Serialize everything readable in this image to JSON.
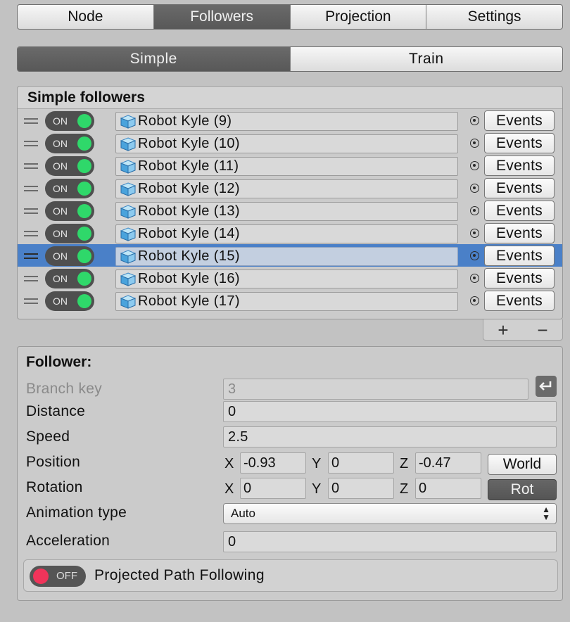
{
  "main_tabs": [
    {
      "label": "Node",
      "active": false
    },
    {
      "label": "Followers",
      "active": true
    },
    {
      "label": "Projection",
      "active": false
    },
    {
      "label": "Settings",
      "active": false
    }
  ],
  "sub_tabs": [
    {
      "label": "Simple",
      "active": true
    },
    {
      "label": "Train",
      "active": false
    }
  ],
  "followers_list": {
    "title": "Simple followers",
    "toggle_on_label": "ON",
    "events_label": "Events",
    "selected_index": 6,
    "items": [
      "Robot Kyle (9)",
      "Robot Kyle (10)",
      "Robot Kyle (11)",
      "Robot Kyle (12)",
      "Robot Kyle (13)",
      "Robot Kyle (14)",
      "Robot Kyle (15)",
      "Robot Kyle (16)",
      "Robot Kyle (17)"
    ],
    "add_label": "+",
    "remove_label": "−"
  },
  "follower": {
    "title": "Follower:",
    "branch_key_label": "Branch key",
    "branch_key_value": "3",
    "distance_label": "Distance",
    "distance_value": "0",
    "speed_label": "Speed",
    "speed_value": "2.5",
    "position_label": "Position",
    "position": {
      "x": "-0.93",
      "y": "0",
      "z": "-0.47"
    },
    "world_label": "World",
    "rotation_label": "Rotation",
    "rotation": {
      "x": "0",
      "y": "0",
      "z": "0"
    },
    "rot_label": "Rot",
    "axis_x": "X",
    "axis_y": "Y",
    "axis_z": "Z",
    "animation_type_label": "Animation type",
    "animation_type_value": "Auto",
    "acceleration_label": "Acceleration",
    "acceleration_value": "0",
    "projected_toggle_label": "OFF",
    "projected_path_label": "Projected Path Following"
  },
  "colors": {
    "background": "#c2c2c2",
    "selection": "#4a80c8",
    "toggle_on": "#2fd86a",
    "toggle_off": "#f0345a",
    "active_tab": "#5f5f5f"
  },
  "icons": {
    "object_icon": "cube-icon",
    "target_icon": "target-icon",
    "drag_icon": "drag-handle-icon",
    "enter_icon": "return-arrow-icon"
  }
}
